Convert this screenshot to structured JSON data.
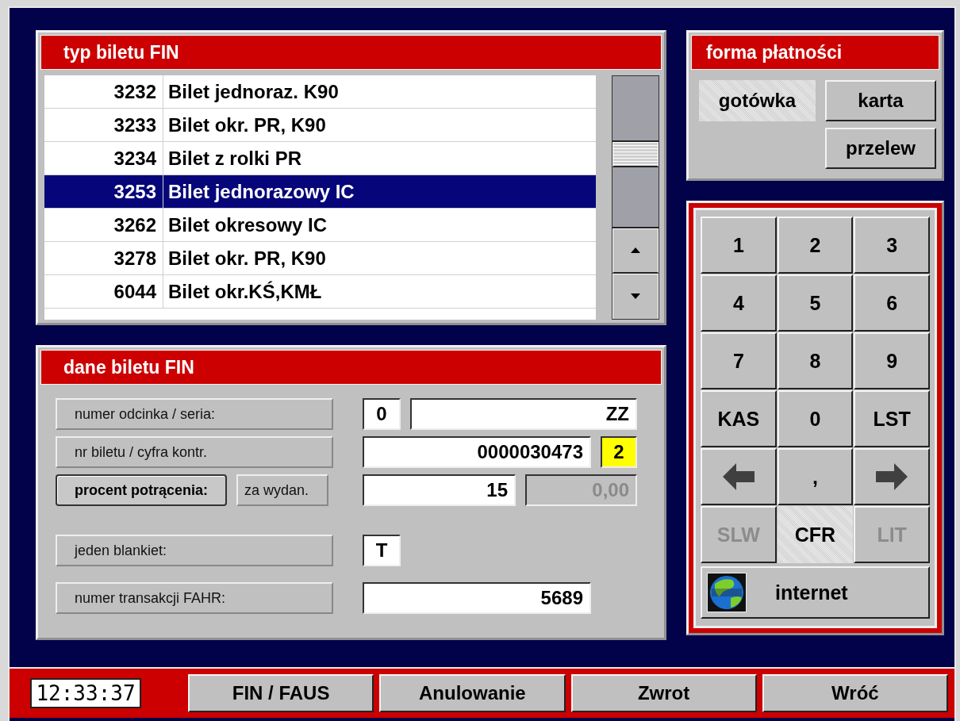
{
  "ticket_types": {
    "title": "typ biletu FIN",
    "rows": [
      {
        "code": "3232",
        "name": "Bilet jednoraz. K90",
        "selected": false
      },
      {
        "code": "3233",
        "name": "Bilet okr. PR, K90",
        "selected": false
      },
      {
        "code": "3234",
        "name": "Bilet z rolki PR",
        "selected": false
      },
      {
        "code": "3253",
        "name": "Bilet jednorazowy IC",
        "selected": true
      },
      {
        "code": "3262",
        "name": "Bilet okresowy IC",
        "selected": false
      },
      {
        "code": "3278",
        "name": "Bilet okr. PR, K90",
        "selected": false
      },
      {
        "code": "6044",
        "name": "Bilet okr.KŚ,KMŁ",
        "selected": false
      }
    ]
  },
  "ticket_data": {
    "title": "dane biletu FIN",
    "rows": [
      {
        "labels": [
          {
            "text": "numer odcinka / seria:",
            "kind": "label"
          }
        ],
        "fields": [
          {
            "value": "0",
            "kind": "tiny",
            "disabled": false,
            "highlighted": false
          },
          {
            "value": "ZZ",
            "kind": "rest",
            "disabled": false,
            "highlighted": false
          }
        ]
      },
      {
        "labels": [
          {
            "text": "nr biletu / cyfra kontr.",
            "kind": "label"
          }
        ],
        "fields": [
          {
            "value": "0000030473",
            "kind": "long",
            "disabled": false,
            "highlighted": false
          },
          {
            "value": "2",
            "kind": "rest",
            "disabled": false,
            "highlighted": true
          }
        ]
      },
      {
        "labels": [
          {
            "text": "procent potrącenia:",
            "kind": "button"
          },
          {
            "text": "za wydan.",
            "kind": "label"
          }
        ],
        "fields": [
          {
            "value": "15",
            "kind": "mid",
            "disabled": false,
            "highlighted": false
          },
          {
            "value": "0,00",
            "kind": "rest",
            "disabled": true,
            "highlighted": false
          }
        ]
      },
      {
        "labels": [
          {
            "text": "jeden blankiet:",
            "kind": "label"
          }
        ],
        "fields": [
          {
            "value": "T",
            "kind": "tiny",
            "disabled": false,
            "highlighted": false
          }
        ]
      },
      {
        "labels": [
          {
            "text": "numer transakcji FAHR:",
            "kind": "label"
          }
        ],
        "fields": [
          {
            "value": "5689",
            "kind": "long",
            "disabled": false,
            "highlighted": false
          }
        ]
      }
    ]
  },
  "payment": {
    "title": "forma płatności",
    "options": [
      {
        "label": "gotówka",
        "selected": true
      },
      {
        "label": "karta",
        "selected": false
      },
      {
        "label": "przelew",
        "selected": false
      }
    ]
  },
  "keypad": {
    "keys": [
      {
        "label": "1",
        "kind": "text",
        "disabled": false,
        "selected": false
      },
      {
        "label": "2",
        "kind": "text",
        "disabled": false,
        "selected": false
      },
      {
        "label": "3",
        "kind": "text",
        "disabled": false,
        "selected": false
      },
      {
        "label": "4",
        "kind": "text",
        "disabled": false,
        "selected": false
      },
      {
        "label": "5",
        "kind": "text",
        "disabled": false,
        "selected": false
      },
      {
        "label": "6",
        "kind": "text",
        "disabled": false,
        "selected": false
      },
      {
        "label": "7",
        "kind": "text",
        "disabled": false,
        "selected": false
      },
      {
        "label": "8",
        "kind": "text",
        "disabled": false,
        "selected": false
      },
      {
        "label": "9",
        "kind": "text",
        "disabled": false,
        "selected": false
      },
      {
        "label": "KAS",
        "kind": "text",
        "disabled": false,
        "selected": false
      },
      {
        "label": "0",
        "kind": "text",
        "disabled": false,
        "selected": false
      },
      {
        "label": "LST",
        "kind": "text",
        "disabled": false,
        "selected": false
      },
      {
        "kind": "left",
        "disabled": false,
        "selected": false
      },
      {
        "label": ",",
        "kind": "text",
        "disabled": false,
        "selected": false
      },
      {
        "kind": "right",
        "disabled": false,
        "selected": false
      },
      {
        "label": "SLW",
        "kind": "text",
        "disabled": true,
        "selected": false
      },
      {
        "label": "CFR",
        "kind": "text",
        "disabled": false,
        "selected": true
      },
      {
        "label": "LIT",
        "kind": "text",
        "disabled": true,
        "selected": false
      }
    ],
    "web_button": {
      "label": "internet"
    }
  },
  "footer": {
    "clock": "12:33:37",
    "buttons": [
      "FIN / FAUS",
      "Anulowanie",
      "Zwrot",
      "Wróć"
    ]
  }
}
